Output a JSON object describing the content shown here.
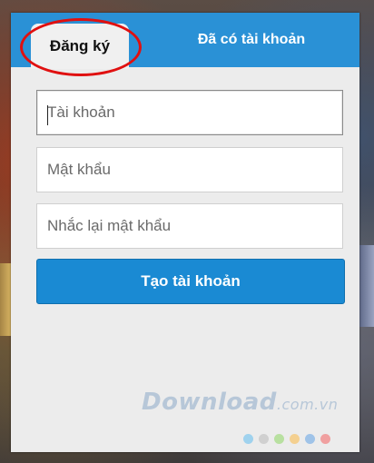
{
  "tabs": {
    "register_label": "Đăng ký",
    "login_label": "Đã có tài khoản"
  },
  "form": {
    "account_placeholder": "Tài khoản",
    "account_value": "",
    "password_placeholder": "Mật khẩu",
    "password_value": "",
    "confirm_password_placeholder": "Nhắc lại mật khẩu",
    "confirm_password_value": "",
    "submit_label": "Tạo tài khoản"
  },
  "watermark": {
    "brand": "Download",
    "domain": ".com.vn"
  },
  "colors": {
    "tab_bar": "#2a91d6",
    "submit": "#1a8ad3",
    "highlight": "#e01010",
    "dots": [
      "#9fd2ee",
      "#d0d0d0",
      "#b8e0a0",
      "#f4d090",
      "#9fc3e8",
      "#f0a0a0"
    ]
  }
}
